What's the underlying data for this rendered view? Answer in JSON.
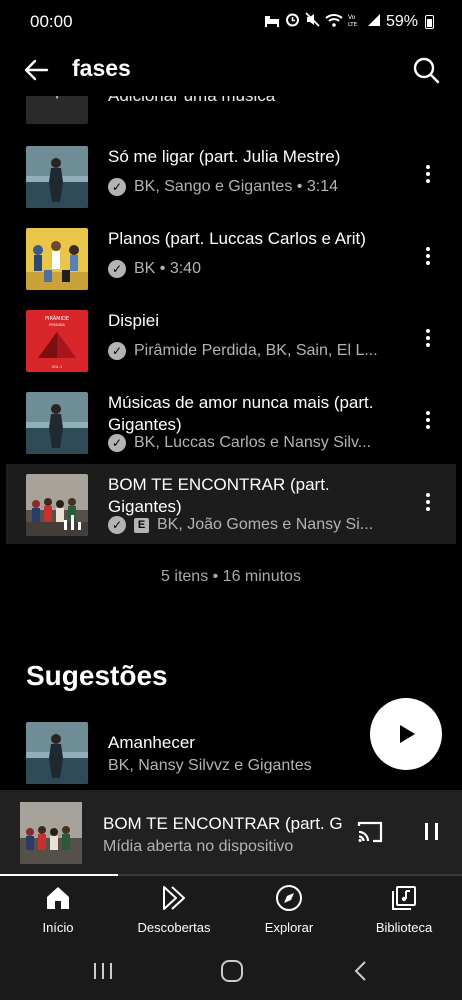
{
  "status_bar": {
    "time": "00:00",
    "battery": "59%"
  },
  "header": {
    "title": "fases"
  },
  "playlist": {
    "add_label": "Adicionar uma música",
    "songs": [
      {
        "title": "Só me ligar (part. Julia Mestre)",
        "meta": "BK, Sango e Gigantes • 3:14",
        "explicit": false
      },
      {
        "title": "Planos (part. Luccas Carlos e Arit)",
        "meta": "BK • 3:40",
        "explicit": false
      },
      {
        "title": "Dispiei",
        "meta": "Pirâmide Perdida, BK, Sain, El L...",
        "explicit": false
      },
      {
        "title": "Músicas de amor nunca mais (part. Gigantes)",
        "meta": "BK, Luccas Carlos e Nansy Silv...",
        "explicit": false
      },
      {
        "title": "BOM TE ENCONTRAR (part. Gigantes)",
        "meta": "BK, João Gomes e Nansy Si...",
        "explicit": true
      }
    ],
    "summary": "5 itens • 16 minutos"
  },
  "suggestions": {
    "title": "Sugestões",
    "items": [
      {
        "title": "Amanhecer",
        "meta": "BK, Nansy Silvvz e Gigantes"
      }
    ]
  },
  "mini_player": {
    "title": "BOM TE ENCONTRAR (part. G",
    "subtitle": "Mídia aberta no dispositivo",
    "progress": 0.255
  },
  "bottom_nav": {
    "items": [
      {
        "label": "Início",
        "icon": "home-icon"
      },
      {
        "label": "Descobertas",
        "icon": "samples-icon"
      },
      {
        "label": "Explorar",
        "icon": "compass-icon"
      },
      {
        "label": "Biblioteca",
        "icon": "library-icon"
      }
    ]
  },
  "colors": {
    "background": "#000000",
    "surface": "#212121",
    "text_secondary": "#b3b3b3",
    "thumb_red": "#d8262a"
  }
}
